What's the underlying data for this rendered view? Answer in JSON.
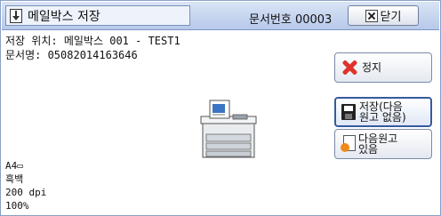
{
  "header": {
    "title": "메일박스 저장",
    "doc_number": "문서번호 00003",
    "close_label": "닫기"
  },
  "info": {
    "location": "저장 위치: 메일박스 001 - TEST1",
    "doc_name": "문서명: 05082014163646"
  },
  "scan_settings": {
    "paper": "A4▭",
    "color": "흑백",
    "resolution": "200 dpi",
    "zoom": "100%"
  },
  "buttons": {
    "stop_label": "정지",
    "store_label_line1": "저장(다음",
    "store_label_line2": "원고 없음)",
    "next_label_line1": "다음원고",
    "next_label_line2": "있음"
  },
  "colors": {
    "titlebar": "#c7d6ef",
    "stop_icon": "#e0322b",
    "accent_border": "#365a9c"
  },
  "icons": {
    "title": "download-arrow-icon",
    "close": "close-x-icon",
    "stop": "red-x-icon",
    "store": "floppy-disk-icon",
    "next": "add-page-icon",
    "device": "multifunction-printer-icon"
  }
}
